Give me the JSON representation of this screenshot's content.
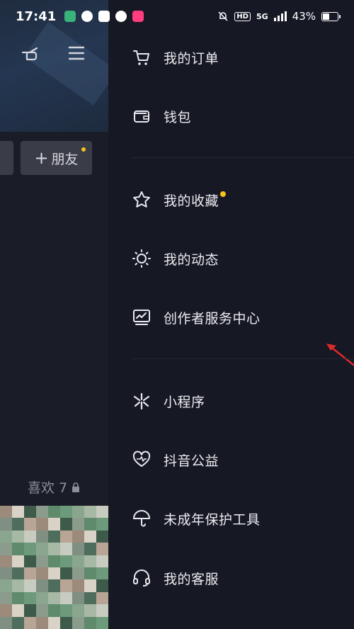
{
  "status_bar": {
    "time": "17:41",
    "network": "5G",
    "battery_percent": "43%",
    "battery_level": 0.43,
    "hd_label": "HD",
    "app_badge_colors": [
      "#39b37a",
      "#ffffff",
      "#ffffff",
      "#ffffff",
      "#ff3d7f"
    ]
  },
  "background": {
    "friends_button_label": "朋友",
    "friends_button_plus": "+",
    "likes_label": "喜欢 7",
    "notification_dot_color": "#f5c31c"
  },
  "drawer": {
    "items": [
      {
        "label": "我的订单",
        "icon": "cart-icon"
      },
      {
        "label": "钱包",
        "icon": "wallet-icon"
      },
      {
        "label": "我的收藏",
        "icon": "star-icon",
        "has_dot": true
      },
      {
        "label": "我的动态",
        "icon": "sun-icon"
      },
      {
        "label": "创作者服务中心",
        "icon": "chart-monitor-icon"
      },
      {
        "label": "小程序",
        "icon": "asterisk-icon"
      },
      {
        "label": "抖音公益",
        "icon": "heart-hand-icon"
      },
      {
        "label": "未成年保护工具",
        "icon": "umbrella-icon"
      },
      {
        "label": "我的客服",
        "icon": "headset-icon"
      }
    ]
  },
  "annotation": {
    "color": "#e02a2a",
    "icon": "red-arrow-annotation"
  }
}
